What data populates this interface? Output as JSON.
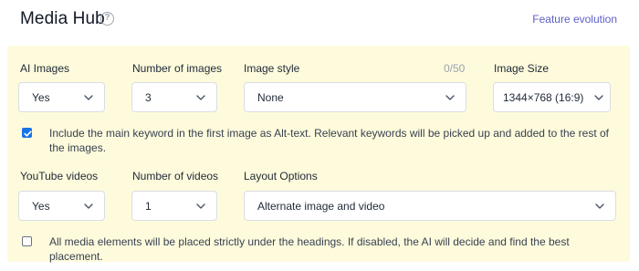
{
  "header": {
    "title": "Media Hub",
    "help_icon": "question-circle-icon",
    "feature_link": "Feature evolution"
  },
  "images_section": {
    "ai_images": {
      "label": "AI Images",
      "value": "Yes"
    },
    "number_of_images": {
      "label": "Number of images",
      "value": "3"
    },
    "image_style": {
      "label": "Image style",
      "counter": "0/50",
      "value": "None"
    },
    "image_size": {
      "label": "Image Size",
      "value": "1344×768 (16:9)"
    },
    "alt_text_option": {
      "checked": true,
      "text": "Include the main keyword in the first image as Alt-text. Relevant keywords will be picked up and added to the rest of the images."
    }
  },
  "videos_section": {
    "youtube_videos": {
      "label": "YouTube videos",
      "value": "Yes"
    },
    "number_of_videos": {
      "label": "Number of videos",
      "value": "1"
    },
    "layout_options": {
      "label": "Layout Options",
      "value": "Alternate image and video"
    },
    "placement_option": {
      "checked": false,
      "text": "All media elements will be placed strictly under the headings. If disabled, the AI will decide and find the best placement."
    }
  },
  "colors": {
    "panel_background": "#fefbdc",
    "link": "#5b5fc7",
    "checkbox_checked": "#1a73e8"
  }
}
